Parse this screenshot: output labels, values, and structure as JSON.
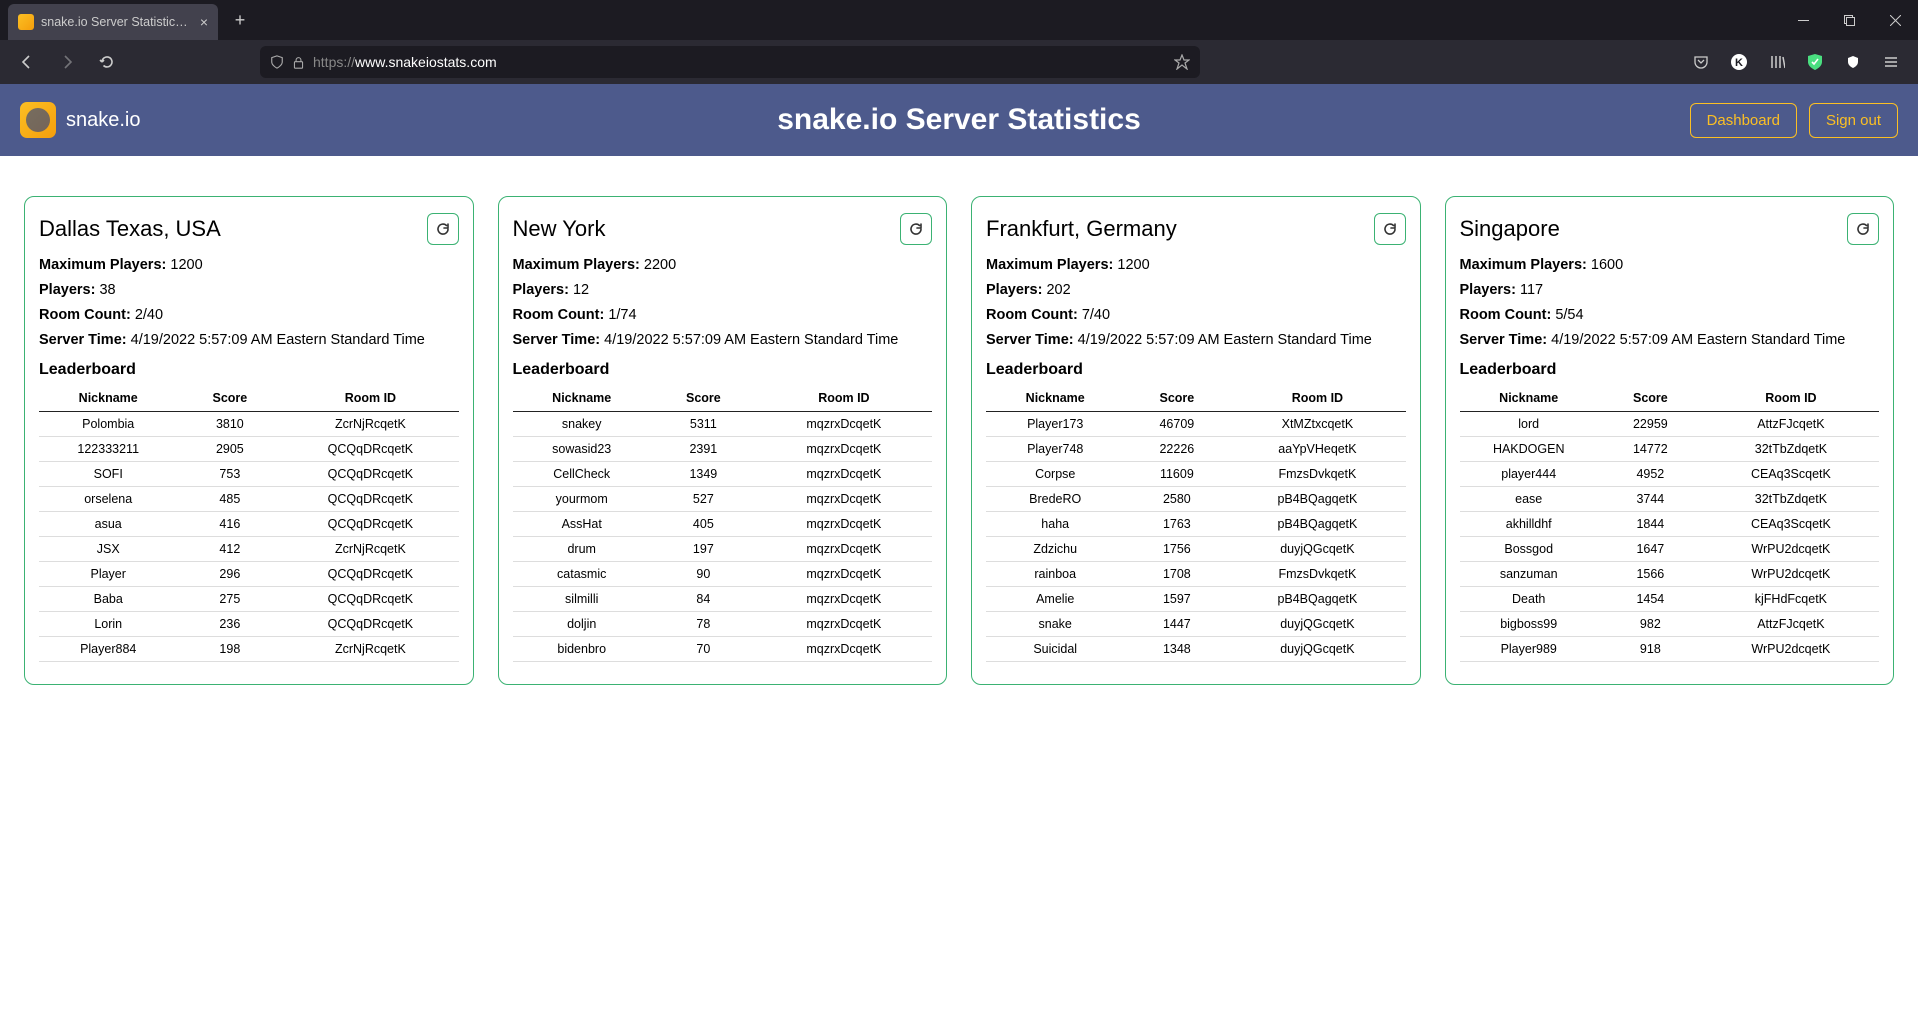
{
  "browser": {
    "tab_title": "snake.io Server Statistics | Home",
    "url_proto": "https://",
    "url_domain": "www.snakeiostats.com"
  },
  "header": {
    "brand": "snake.io",
    "title": "snake.io Server Statistics",
    "dashboard": "Dashboard",
    "signout": "Sign out"
  },
  "labels": {
    "max_players": "Maximum Players: ",
    "players": "Players: ",
    "room_count": "Room Count: ",
    "server_time": "Server Time: ",
    "leaderboard": "Leaderboard",
    "th_nick": "Nickname",
    "th_score": "Score",
    "th_room": "Room ID"
  },
  "server_time_value": "4/19/2022 5:57:09 AM Eastern Standard Time",
  "servers": [
    {
      "name": "Dallas Texas, USA",
      "max_players": "1200",
      "players": "38",
      "room_count": "2/40",
      "rows": [
        {
          "nick": "Polombia",
          "score": "3810",
          "room": "ZcrNjRcqetK"
        },
        {
          "nick": "122333211",
          "score": "2905",
          "room": "QCQqDRcqetK"
        },
        {
          "nick": "SOFI",
          "score": "753",
          "room": "QCQqDRcqetK"
        },
        {
          "nick": "orselena",
          "score": "485",
          "room": "QCQqDRcqetK"
        },
        {
          "nick": "asua",
          "score": "416",
          "room": "QCQqDRcqetK"
        },
        {
          "nick": "JSX",
          "score": "412",
          "room": "ZcrNjRcqetK"
        },
        {
          "nick": "Player",
          "score": "296",
          "room": "QCQqDRcqetK"
        },
        {
          "nick": "Baba",
          "score": "275",
          "room": "QCQqDRcqetK"
        },
        {
          "nick": "Lorin",
          "score": "236",
          "room": "QCQqDRcqetK"
        },
        {
          "nick": "Player884",
          "score": "198",
          "room": "ZcrNjRcqetK"
        }
      ]
    },
    {
      "name": "New York",
      "max_players": "2200",
      "players": "12",
      "room_count": "1/74",
      "rows": [
        {
          "nick": "snakey",
          "score": "5311",
          "room": "mqzrxDcqetK"
        },
        {
          "nick": "sowasid23",
          "score": "2391",
          "room": "mqzrxDcqetK"
        },
        {
          "nick": "CellCheck",
          "score": "1349",
          "room": "mqzrxDcqetK"
        },
        {
          "nick": "yourmom",
          "score": "527",
          "room": "mqzrxDcqetK"
        },
        {
          "nick": "AssHat",
          "score": "405",
          "room": "mqzrxDcqetK"
        },
        {
          "nick": "drum",
          "score": "197",
          "room": "mqzrxDcqetK"
        },
        {
          "nick": "catasmic",
          "score": "90",
          "room": "mqzrxDcqetK"
        },
        {
          "nick": "silmilli",
          "score": "84",
          "room": "mqzrxDcqetK"
        },
        {
          "nick": "doljin",
          "score": "78",
          "room": "mqzrxDcqetK"
        },
        {
          "nick": "bidenbro",
          "score": "70",
          "room": "mqzrxDcqetK"
        }
      ]
    },
    {
      "name": "Frankfurt, Germany",
      "max_players": "1200",
      "players": "202",
      "room_count": "7/40",
      "rows": [
        {
          "nick": "Player173",
          "score": "46709",
          "room": "XtMZtxcqetK"
        },
        {
          "nick": "Player748",
          "score": "22226",
          "room": "aaYpVHeqetK"
        },
        {
          "nick": "Corpse",
          "score": "11609",
          "room": "FmzsDvkqetK"
        },
        {
          "nick": "BredeRO",
          "score": "2580",
          "room": "pB4BQagqetK"
        },
        {
          "nick": "haha",
          "score": "1763",
          "room": "pB4BQagqetK"
        },
        {
          "nick": "Zdzichu",
          "score": "1756",
          "room": "duyjQGcqetK"
        },
        {
          "nick": "rainboa",
          "score": "1708",
          "room": "FmzsDvkqetK"
        },
        {
          "nick": "Amelie",
          "score": "1597",
          "room": "pB4BQagqetK"
        },
        {
          "nick": "snake",
          "score": "1447",
          "room": "duyjQGcqetK"
        },
        {
          "nick": "Suicidal",
          "score": "1348",
          "room": "duyjQGcqetK"
        }
      ]
    },
    {
      "name": "Singapore",
      "max_players": "1600",
      "players": "117",
      "room_count": "5/54",
      "rows": [
        {
          "nick": "lord",
          "score": "22959",
          "room": "AttzFJcqetK"
        },
        {
          "nick": "HAKDOGEN",
          "score": "14772",
          "room": "32tTbZdqetK"
        },
        {
          "nick": "player444",
          "score": "4952",
          "room": "CEAq3ScqetK"
        },
        {
          "nick": "ease",
          "score": "3744",
          "room": "32tTbZdqetK"
        },
        {
          "nick": "akhilldhf",
          "score": "1844",
          "room": "CEAq3ScqetK"
        },
        {
          "nick": "Bossgod",
          "score": "1647",
          "room": "WrPU2dcqetK"
        },
        {
          "nick": "sanzuman",
          "score": "1566",
          "room": "WrPU2dcqetK"
        },
        {
          "nick": "Death",
          "score": "1454",
          "room": "kjFHdFcqetK"
        },
        {
          "nick": "bigboss99",
          "score": "982",
          "room": "AttzFJcqetK"
        },
        {
          "nick": "Player989",
          "score": "918",
          "room": "WrPU2dcqetK"
        }
      ]
    }
  ]
}
